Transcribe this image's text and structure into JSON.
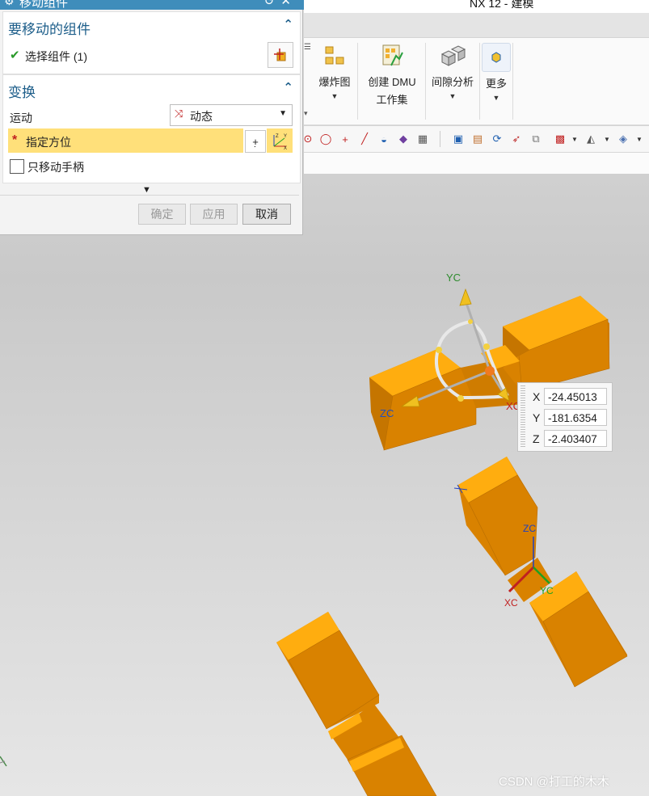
{
  "app": {
    "title": "NX 12 - 建模"
  },
  "ribbon": {
    "items": [
      {
        "label_line1": "爆炸图",
        "label_line2": "",
        "icon": "exploded-view-icon"
      },
      {
        "label_line1": "创建 DMU",
        "label_line2": "工作集",
        "icon": "dmu-workset-icon"
      },
      {
        "label_line1": "间隙分析",
        "label_line2": "",
        "icon": "clearance-analysis-icon"
      },
      {
        "label_line1": "更多",
        "label_line2": "",
        "icon": "more-icon"
      }
    ]
  },
  "dialog": {
    "title": "移动组件",
    "components_group": {
      "title": "要移动的组件",
      "select_label": "选择组件 (1)"
    },
    "transform_group": {
      "title": "变换",
      "motion_label": "运动",
      "motion_value": "动态",
      "specify_orientation_label": "指定方位",
      "only_move_handle_label": "只移动手柄",
      "only_move_handle_checked": false
    },
    "buttons": {
      "ok": "确定",
      "apply": "应用",
      "cancel": "取消"
    }
  },
  "coordinates": {
    "x_label": "X",
    "x_value": "-24.45013",
    "y_label": "Y",
    "y_value": "-181.6354",
    "z_label": "Z",
    "z_value": "-2.403407"
  },
  "triad_labels": {
    "handle_yc": "YC",
    "handle_zc": "ZC",
    "handle_xc": "XC",
    "wcs_zc": "ZC",
    "wcs_xc": "XC",
    "wcs_yc": "YC"
  },
  "watermark": "CSDN @打工的木木",
  "colors": {
    "dialog_title_bar": "#3f8dbb",
    "group_heading": "#1d5e8a",
    "highlight_row": "#ffe07a",
    "part_face_top": "#ffad0f",
    "part_face_front": "#d98200"
  }
}
